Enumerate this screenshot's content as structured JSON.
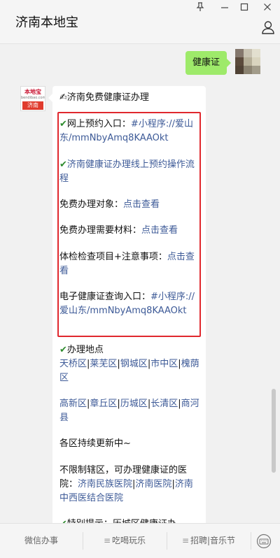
{
  "app": {
    "title": "济南本地宝"
  },
  "window_controls": {
    "pin": "⚓",
    "minimize": "–",
    "maximize": "□",
    "close": "✕"
  },
  "icons": {
    "user": "user-icon",
    "keyboard": "keyboard-icon",
    "check": "✔",
    "pencil": "✍"
  },
  "chat": {
    "user_message": "健康证",
    "bot_logo": {
      "top": "本地宝",
      "small": "bendibao.com",
      "bottom": "济南"
    },
    "bot": {
      "heading": "济南免费健康证办理",
      "item1_label": "网上预约入口：",
      "item1_link": "#小程序://爱山东/mmNbyAmq8KAAOkt",
      "item2_link": "济南健康证办理线上预约操作流程",
      "item3_label": "免费办理对象：",
      "item3_link": "点击查看",
      "item4_label": "免费办理需要材料：",
      "item4_link": "点击查看",
      "item5_label": "体检检查项目+注意事项：",
      "item5_link": "点击查看",
      "item6_label": "电子健康证查询入口：",
      "item6_link": "#小程序://爱山东/mmNbyAmq8KAAOkt",
      "location_heading": "办理地点",
      "districts1": [
        "天桥区",
        "莱芜区",
        "钢城区",
        "市中区",
        "槐荫区"
      ],
      "districts2": [
        "高新区",
        "章丘区",
        "历城区",
        "长清区",
        "商河县"
      ],
      "updating": "各区持续更新中~",
      "hospital_label": "不限制辖区，可办理健康证的医院：",
      "hospitals": [
        "济南民族医院",
        "济南医院",
        "济南中西医结合医院"
      ],
      "tip_partial": "特别提示：历城区健康证办"
    }
  },
  "bottom_menu": [
    "微信办事",
    "吃喝玩乐",
    "招聘|音乐节"
  ]
}
